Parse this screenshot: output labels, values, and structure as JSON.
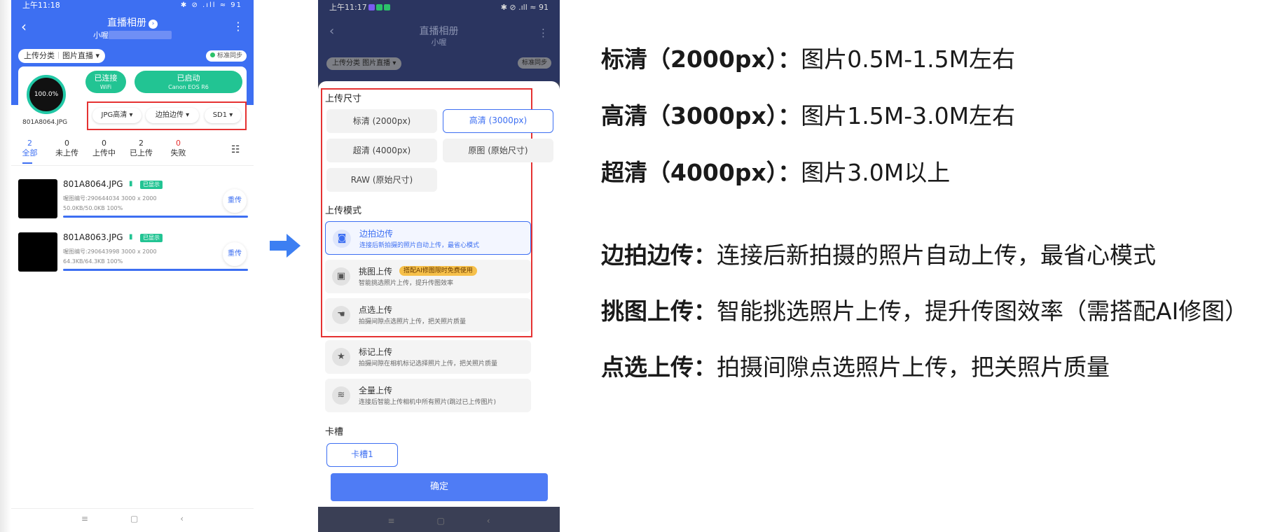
{
  "left_phone": {
    "status_time": "上午11:18",
    "status_icons": "✱ ⊘ .ıll ≈ 91",
    "title": "直播相册",
    "user": "小喔",
    "category_label": "上传分类",
    "category_value": "图片直播",
    "sync_label": "标准同步",
    "progress": "100.0%",
    "file_name": "801A8064.JPG",
    "wifi_status": "已连接",
    "wifi_sub": "WiFi",
    "camera_status": "已启动",
    "camera_sub": "Canon EOS R6",
    "dropdowns": [
      "JPG高清 ▾",
      "边拍边传 ▾",
      "SD1 ▾"
    ],
    "tabs": [
      {
        "count": "2",
        "label": "全部"
      },
      {
        "count": "0",
        "label": "未上传"
      },
      {
        "count": "0",
        "label": "上传中"
      },
      {
        "count": "2",
        "label": "已上传"
      },
      {
        "count": "0",
        "label": "失败"
      }
    ],
    "files": [
      {
        "name": "801A8064.JPG",
        "badge": "已显示",
        "meta": "喔图编号:290644034    3000 x 2000",
        "size": "50.0KB/50.0KB    100%",
        "progress": 1.0,
        "action": "重传"
      },
      {
        "name": "801A8063.JPG",
        "badge": "已显示",
        "meta": "喔图编号:290643998    3000 x 2000",
        "size": "64.3KB/64.3KB    100%",
        "progress": 1.0,
        "action": "重传"
      }
    ],
    "nav": [
      "≡",
      "▢",
      "‹"
    ]
  },
  "right_phone": {
    "status_time": "上午11:17",
    "status_icons": "✱ ⊘ .ıll ≈ 91",
    "title": "直播相册",
    "user": "小喔",
    "category": "上传分类  图片直播 ▾",
    "sync_label": "标准同步",
    "size_title": "上传尺寸",
    "sizes": [
      "标清 (2000px)",
      "高清 (3000px)",
      "超清 (4000px)",
      "原图 (原始尺寸)",
      "RAW (原始尺寸)"
    ],
    "selected_size": "高清 (3000px)",
    "mode_title": "上传模式",
    "modes": [
      {
        "title": "边拍边传",
        "desc": "连接后新拍摄的照片自动上传，最省心模式",
        "icon": "camera-icon"
      },
      {
        "title": "挑图上传",
        "desc": "智能挑选照片上传，提升传图效率",
        "tag": "搭配AI修图限时免费使用",
        "icon": "image-pick-icon"
      },
      {
        "title": "点选上传",
        "desc": "拍摄间隙点选照片上传，把关照片质量",
        "icon": "tap-select-icon"
      },
      {
        "title": "标记上传",
        "desc": "拍摄间隙在相机标记选择照片上传，把关照片质量",
        "icon": "star-icon"
      },
      {
        "title": "全量上传",
        "desc": "连接后智能上传相机中所有照片(跳过已上传图片)",
        "icon": "layers-icon"
      }
    ],
    "selected_mode": "边拍边传",
    "slot_title": "卡槽",
    "slot_value": "卡槽1",
    "confirm": "确定",
    "nav": [
      "≡",
      "▢",
      "‹"
    ]
  },
  "explanations": {
    "size_lines": [
      {
        "term": "标清（2000px）：",
        "desc": "图片0.5M-1.5M左右"
      },
      {
        "term": "高清（3000px）：",
        "desc": "图片1.5M-3.0M左右"
      },
      {
        "term": "超清（4000px）：",
        "desc": "图片3.0M以上"
      }
    ],
    "mode_lines": [
      {
        "term": "边拍边传：",
        "desc": "连接后新拍摄的照片自动上传，最省心模式"
      },
      {
        "term": "挑图上传：",
        "desc": "智能挑选照片上传，提升传图效率（需搭配AI修图）"
      },
      {
        "term": "点选上传：",
        "desc": "拍摄间隙点选照片上传，把关照片质量"
      }
    ]
  },
  "colors": {
    "brand_blue": "#3d6ff2",
    "green": "#22c493",
    "highlight_red": "#e53232"
  }
}
